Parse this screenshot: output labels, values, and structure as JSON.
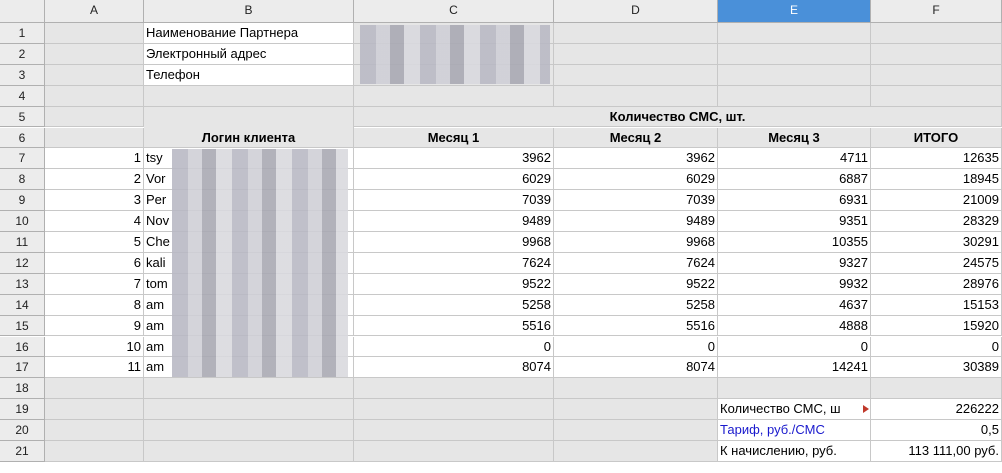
{
  "columns": [
    "A",
    "B",
    "C",
    "D",
    "E",
    "F"
  ],
  "selected_column": "E",
  "row_numbers": [
    "1",
    "2",
    "3",
    "4",
    "5",
    "6",
    "7",
    "8",
    "9",
    "10",
    "11",
    "12",
    "13",
    "14",
    "15",
    "16",
    "17",
    "18",
    "19",
    "20",
    "21"
  ],
  "info": {
    "partner_label": "Наименование Партнера",
    "email_label": "Электронный адрес",
    "phone_label": "Телефон"
  },
  "table": {
    "group_header": "Количество СМС, шт.",
    "login_header": "Логин клиента",
    "month1_header": "Месяц 1",
    "month2_header": "Месяц 2",
    "month3_header": "Месяц 3",
    "total_header": "ИТОГО",
    "rows": [
      {
        "n": "1",
        "login": "tsy",
        "m1": "3962",
        "m2": "3962",
        "m3": "4711",
        "total": "12635"
      },
      {
        "n": "2",
        "login": "Vor",
        "m1": "6029",
        "m2": "6029",
        "m3": "6887",
        "total": "18945"
      },
      {
        "n": "3",
        "login": "Per",
        "m1": "7039",
        "m2": "7039",
        "m3": "6931",
        "total": "21009"
      },
      {
        "n": "4",
        "login": "Nov",
        "m1": "9489",
        "m2": "9489",
        "m3": "9351",
        "total": "28329"
      },
      {
        "n": "5",
        "login": "Che",
        "m1": "9968",
        "m2": "9968",
        "m3": "10355",
        "total": "30291"
      },
      {
        "n": "6",
        "login": "kali",
        "m1": "7624",
        "m2": "7624",
        "m3": "9327",
        "total": "24575"
      },
      {
        "n": "7",
        "login": "tom",
        "m1": "9522",
        "m2": "9522",
        "m3": "9932",
        "total": "28976"
      },
      {
        "n": "8",
        "login": "am",
        "m1": "5258",
        "m2": "5258",
        "m3": "4637",
        "total": "15153"
      },
      {
        "n": "9",
        "login": "am",
        "m1": "5516",
        "m2": "5516",
        "m3": "4888",
        "total": "15920"
      },
      {
        "n": "10",
        "login": "am",
        "m1": "0",
        "m2": "0",
        "m3": "0",
        "total": "0"
      },
      {
        "n": "11",
        "login": "am",
        "m1": "8074",
        "m2": "8074",
        "m3": "14241",
        "total": "30389"
      }
    ]
  },
  "summary": {
    "count_label": "Количество СМС, ш",
    "count_value": "226222",
    "tariff_label": "Тариф, руб./СМС",
    "tariff_value": "0,5",
    "charge_label": "К начислению, руб.",
    "charge_value": "113 111,00 руб."
  },
  "colors": {
    "header_bg": "#ececec",
    "selected_header": "#4a90d9",
    "cell_gray": "#e6e6e6",
    "tariff_text": "#1a1acd"
  }
}
